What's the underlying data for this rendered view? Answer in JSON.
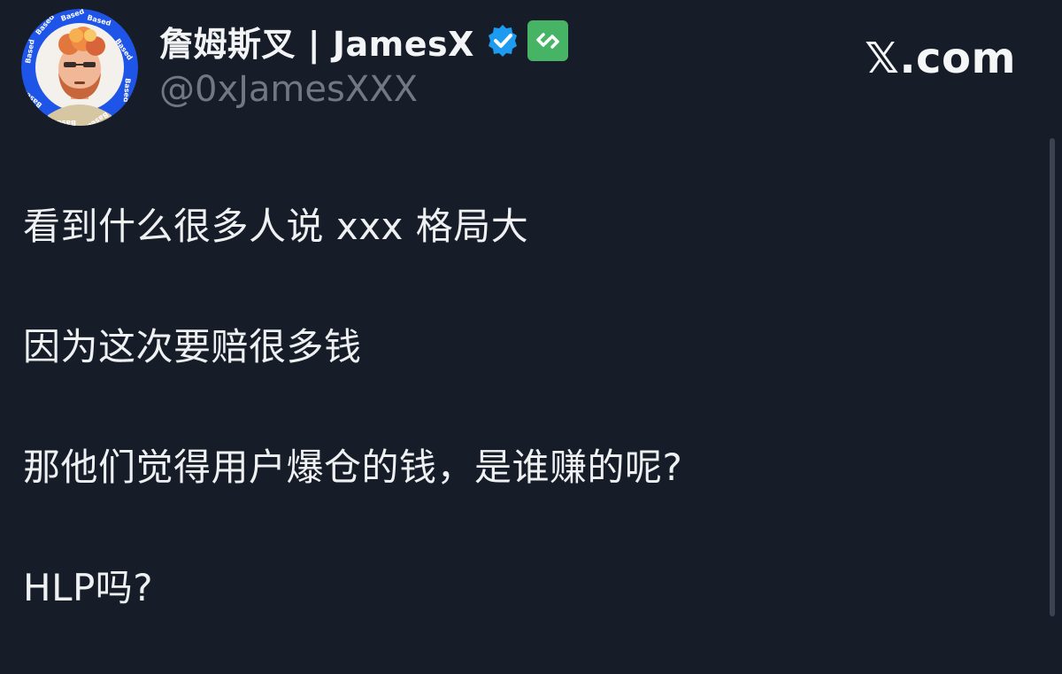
{
  "author": {
    "display_name": "詹姆斯叉 | JamesX",
    "handle": "@0xJamesXXX",
    "avatar_ring_text": "Based"
  },
  "site": {
    "label": "𝕏.com"
  },
  "post": {
    "lines": [
      "看到什么很多人说 xxx 格局大",
      "因为这次要赔很多钱",
      "那他们觉得用户爆仓的钱，是谁赚的呢?",
      "HLP吗?"
    ]
  },
  "colors": {
    "background": "#161d28",
    "avatar_ring": "#1f54e8",
    "verified": "#1d9bf0",
    "affiliate_badge": "#47b365",
    "handle_text": "#6f7883"
  },
  "icons": {
    "verified": "verified-badge-icon",
    "affiliate": "affiliate-badge-icon"
  }
}
